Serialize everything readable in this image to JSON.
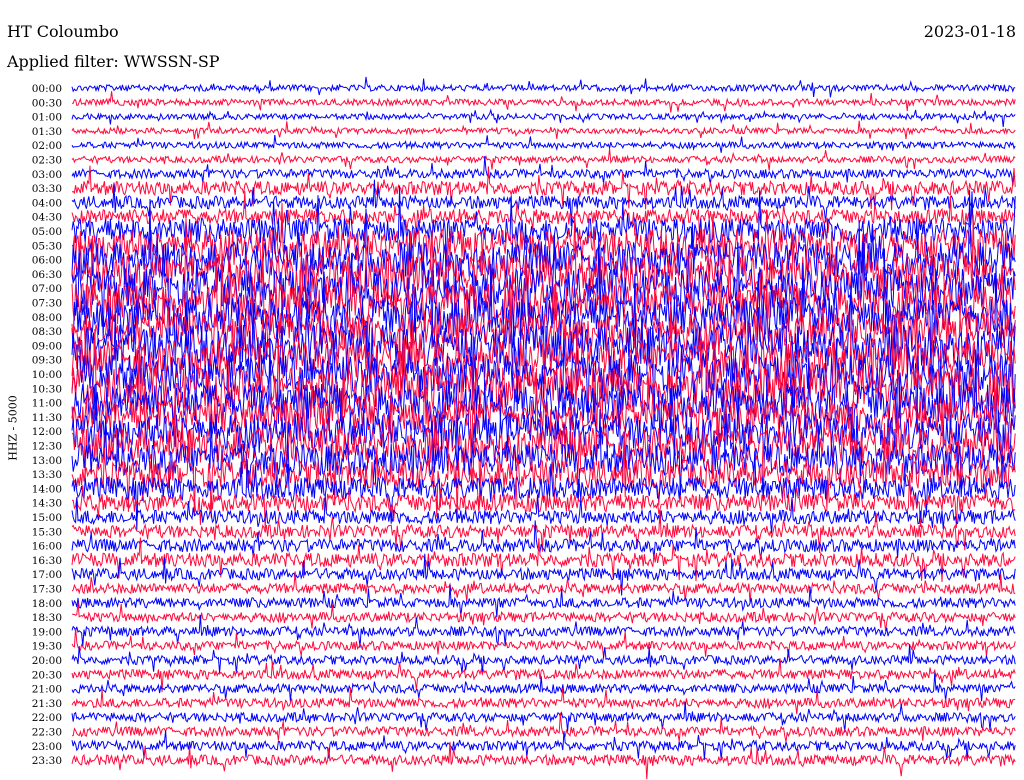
{
  "header": {
    "station": "HT Coloumbo",
    "date": "2023-01-18",
    "filter": "Applied filter: WWSSN-SP"
  },
  "channel_label": "HHZ - 5000",
  "colors": {
    "trace_a": "#0000ff",
    "trace_b": "#ff0a3c",
    "background": "#ffffff",
    "text": "#000000"
  },
  "chart_data": {
    "type": "line",
    "title": "HT Coloumbo",
    "subtitle": "2023-01-18",
    "ylabel": "HHZ - 5000",
    "xlabel": "",
    "row_labels": [
      "00:00",
      "00:30",
      "01:00",
      "01:30",
      "02:00",
      "02:30",
      "03:00",
      "03:30",
      "04:00",
      "04:30",
      "05:00",
      "05:30",
      "06:00",
      "06:30",
      "07:00",
      "07:30",
      "08:00",
      "08:30",
      "09:00",
      "09:30",
      "10:00",
      "10:30",
      "11:00",
      "11:30",
      "12:00",
      "12:30",
      "13:00",
      "13:30",
      "14:00",
      "14:30",
      "15:00",
      "15:30",
      "16:00",
      "16:30",
      "17:00",
      "17:30",
      "18:00",
      "18:30",
      "19:00",
      "19:30",
      "20:00",
      "20:30",
      "21:00",
      "21:30",
      "22:00",
      "22:30",
      "23:00",
      "23:30"
    ],
    "row_colors": [
      "blue",
      "red"
    ],
    "relative_amplitude": [
      1.0,
      1.0,
      0.9,
      0.9,
      1.0,
      1.0,
      1.4,
      2.2,
      2.0,
      2.4,
      4.0,
      5.0,
      5.5,
      6.0,
      6.0,
      6.0,
      6.0,
      6.0,
      6.5,
      6.0,
      6.0,
      6.5,
      6.0,
      5.5,
      5.5,
      5.5,
      5.0,
      4.5,
      3.5,
      2.8,
      2.2,
      2.0,
      2.0,
      2.2,
      1.8,
      1.6,
      1.6,
      1.5,
      1.5,
      1.4,
      1.4,
      1.5,
      1.4,
      1.5,
      1.4,
      1.5,
      1.5,
      1.6
    ]
  }
}
